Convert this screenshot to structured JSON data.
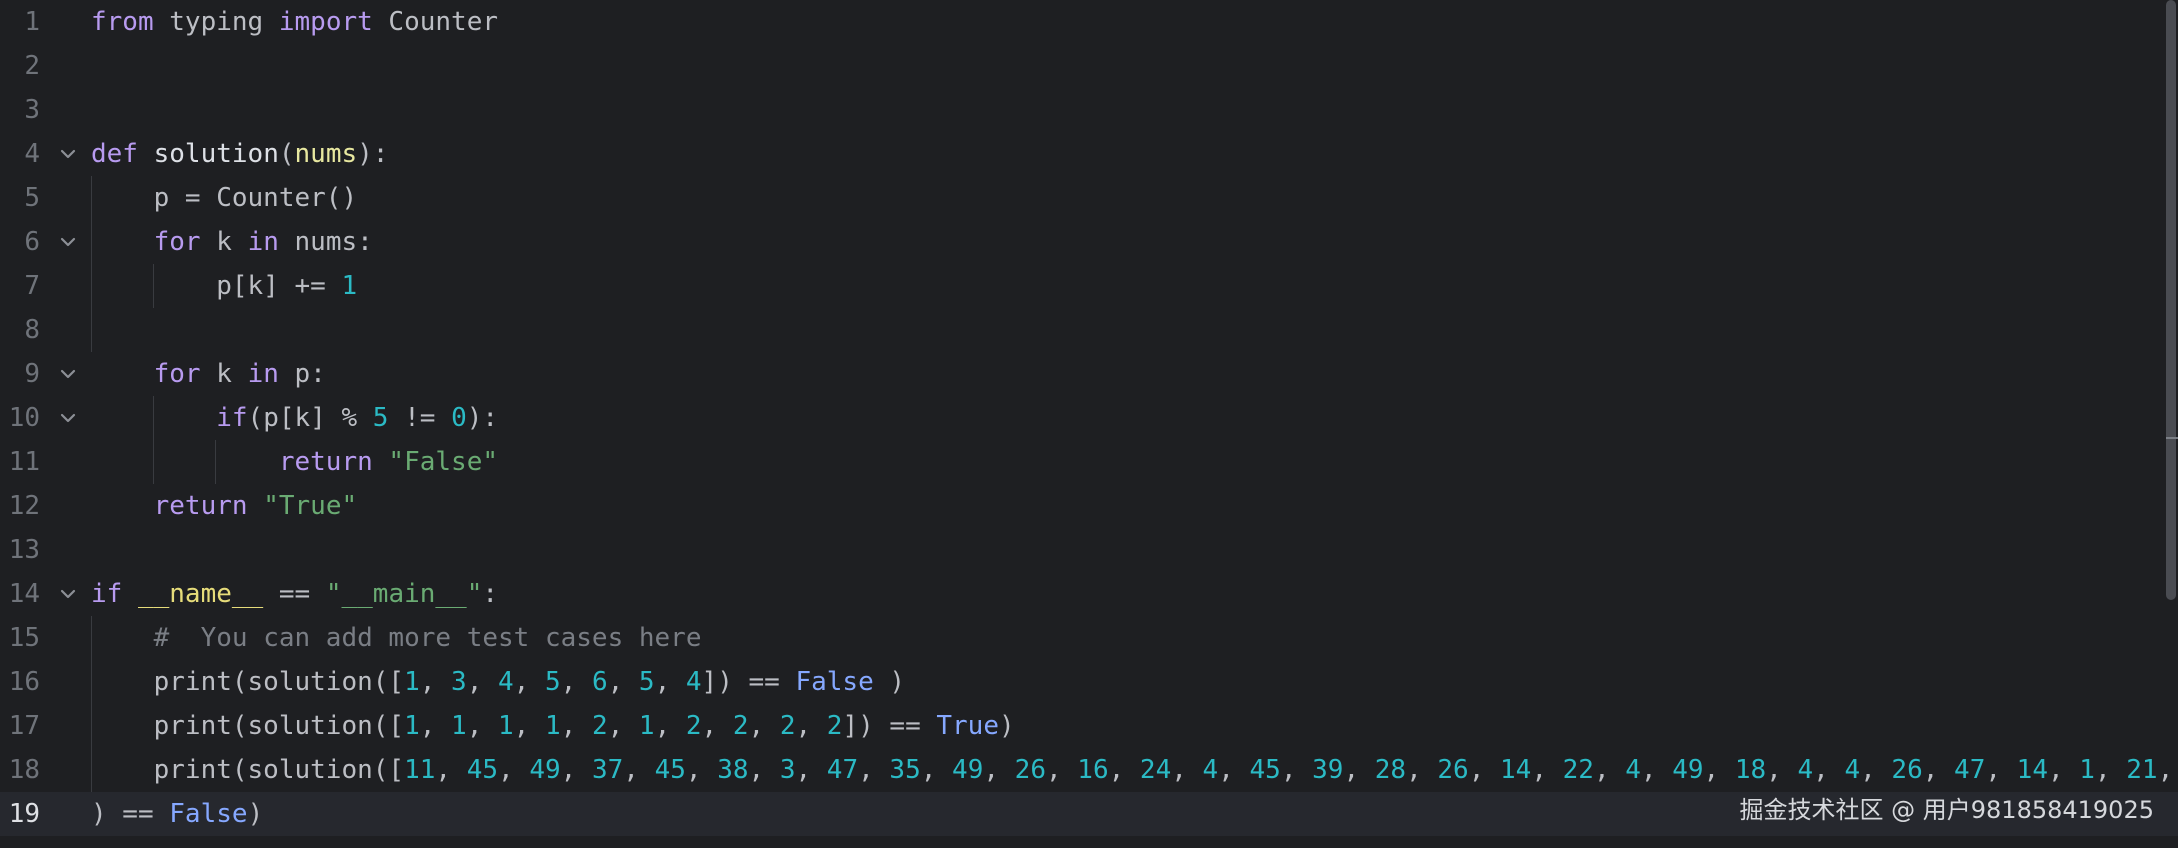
{
  "editor": {
    "lines": [
      {
        "num": "1",
        "tokens": [
          {
            "t": "kw",
            "v": "from"
          },
          {
            "t": "txt",
            "v": " typing "
          },
          {
            "t": "kw",
            "v": "import"
          },
          {
            "t": "txt",
            "v": " Counter"
          }
        ]
      },
      {
        "num": "2",
        "tokens": []
      },
      {
        "num": "3",
        "tokens": []
      },
      {
        "num": "4",
        "fold": true,
        "tokens": [
          {
            "t": "kw",
            "v": "def"
          },
          {
            "t": "txt",
            "v": " "
          },
          {
            "t": "fn",
            "v": "solution"
          },
          {
            "t": "txt",
            "v": "("
          },
          {
            "t": "param",
            "v": "nums"
          },
          {
            "t": "txt",
            "v": "):"
          }
        ]
      },
      {
        "num": "5",
        "tokens": [
          {
            "t": "txt",
            "v": "    p = Counter()"
          }
        ]
      },
      {
        "num": "6",
        "fold": true,
        "tokens": [
          {
            "t": "txt",
            "v": "    "
          },
          {
            "t": "kw",
            "v": "for"
          },
          {
            "t": "txt",
            "v": " k "
          },
          {
            "t": "kw",
            "v": "in"
          },
          {
            "t": "txt",
            "v": " nums:"
          }
        ]
      },
      {
        "num": "7",
        "tokens": [
          {
            "t": "txt",
            "v": "        p[k] += "
          },
          {
            "t": "num",
            "v": "1"
          }
        ]
      },
      {
        "num": "8",
        "tokens": []
      },
      {
        "num": "9",
        "fold": true,
        "tokens": [
          {
            "t": "txt",
            "v": "    "
          },
          {
            "t": "kw",
            "v": "for"
          },
          {
            "t": "txt",
            "v": " k "
          },
          {
            "t": "kw",
            "v": "in"
          },
          {
            "t": "txt",
            "v": " p:"
          }
        ]
      },
      {
        "num": "10",
        "fold": true,
        "tokens": [
          {
            "t": "txt",
            "v": "        "
          },
          {
            "t": "kw",
            "v": "if"
          },
          {
            "t": "txt",
            "v": "(p[k] % "
          },
          {
            "t": "num",
            "v": "5"
          },
          {
            "t": "txt",
            "v": " != "
          },
          {
            "t": "num",
            "v": "0"
          },
          {
            "t": "txt",
            "v": "):"
          }
        ]
      },
      {
        "num": "11",
        "tokens": [
          {
            "t": "txt",
            "v": "            "
          },
          {
            "t": "kw",
            "v": "return"
          },
          {
            "t": "txt",
            "v": " "
          },
          {
            "t": "str",
            "v": "\"False\""
          }
        ]
      },
      {
        "num": "12",
        "tokens": [
          {
            "t": "txt",
            "v": "    "
          },
          {
            "t": "kw",
            "v": "return"
          },
          {
            "t": "txt",
            "v": " "
          },
          {
            "t": "str",
            "v": "\"True\""
          }
        ]
      },
      {
        "num": "13",
        "tokens": []
      },
      {
        "num": "14",
        "fold": true,
        "tokens": [
          {
            "t": "kw",
            "v": "if"
          },
          {
            "t": "txt",
            "v": " "
          },
          {
            "t": "dunder",
            "v": "__name__"
          },
          {
            "t": "txt",
            "v": " == "
          },
          {
            "t": "str",
            "v": "\"__main__\""
          },
          {
            "t": "txt",
            "v": ":"
          }
        ]
      },
      {
        "num": "15",
        "tokens": [
          {
            "t": "txt",
            "v": "    "
          },
          {
            "t": "comment",
            "v": "#  You can add more test cases here"
          }
        ]
      },
      {
        "num": "16",
        "tokens": [
          {
            "t": "txt",
            "v": "    print(solution(["
          },
          {
            "t": "num",
            "v": "1"
          },
          {
            "t": "txt",
            "v": ", "
          },
          {
            "t": "num",
            "v": "3"
          },
          {
            "t": "txt",
            "v": ", "
          },
          {
            "t": "num",
            "v": "4"
          },
          {
            "t": "txt",
            "v": ", "
          },
          {
            "t": "num",
            "v": "5"
          },
          {
            "t": "txt",
            "v": ", "
          },
          {
            "t": "num",
            "v": "6"
          },
          {
            "t": "txt",
            "v": ", "
          },
          {
            "t": "num",
            "v": "5"
          },
          {
            "t": "txt",
            "v": ", "
          },
          {
            "t": "num",
            "v": "4"
          },
          {
            "t": "txt",
            "v": "]) == "
          },
          {
            "t": "bool",
            "v": "False"
          },
          {
            "t": "txt",
            "v": " )"
          }
        ]
      },
      {
        "num": "17",
        "tokens": [
          {
            "t": "txt",
            "v": "    print(solution(["
          },
          {
            "t": "num",
            "v": "1"
          },
          {
            "t": "txt",
            "v": ", "
          },
          {
            "t": "num",
            "v": "1"
          },
          {
            "t": "txt",
            "v": ", "
          },
          {
            "t": "num",
            "v": "1"
          },
          {
            "t": "txt",
            "v": ", "
          },
          {
            "t": "num",
            "v": "1"
          },
          {
            "t": "txt",
            "v": ", "
          },
          {
            "t": "num",
            "v": "2"
          },
          {
            "t": "txt",
            "v": ", "
          },
          {
            "t": "num",
            "v": "1"
          },
          {
            "t": "txt",
            "v": ", "
          },
          {
            "t": "num",
            "v": "2"
          },
          {
            "t": "txt",
            "v": ", "
          },
          {
            "t": "num",
            "v": "2"
          },
          {
            "t": "txt",
            "v": ", "
          },
          {
            "t": "num",
            "v": "2"
          },
          {
            "t": "txt",
            "v": ", "
          },
          {
            "t": "num",
            "v": "2"
          },
          {
            "t": "txt",
            "v": "]) == "
          },
          {
            "t": "bool",
            "v": "True"
          },
          {
            "t": "txt",
            "v": ")"
          }
        ]
      },
      {
        "num": "18",
        "tokens": [
          {
            "t": "txt",
            "v": "    print(solution(["
          },
          {
            "t": "num",
            "v": "11"
          },
          {
            "t": "txt",
            "v": ", "
          },
          {
            "t": "num",
            "v": "45"
          },
          {
            "t": "txt",
            "v": ", "
          },
          {
            "t": "num",
            "v": "49"
          },
          {
            "t": "txt",
            "v": ", "
          },
          {
            "t": "num",
            "v": "37"
          },
          {
            "t": "txt",
            "v": ", "
          },
          {
            "t": "num",
            "v": "45"
          },
          {
            "t": "txt",
            "v": ", "
          },
          {
            "t": "num",
            "v": "38"
          },
          {
            "t": "txt",
            "v": ", "
          },
          {
            "t": "num",
            "v": "3"
          },
          {
            "t": "txt",
            "v": ", "
          },
          {
            "t": "num",
            "v": "47"
          },
          {
            "t": "txt",
            "v": ", "
          },
          {
            "t": "num",
            "v": "35"
          },
          {
            "t": "txt",
            "v": ", "
          },
          {
            "t": "num",
            "v": "49"
          },
          {
            "t": "txt",
            "v": ", "
          },
          {
            "t": "num",
            "v": "26"
          },
          {
            "t": "txt",
            "v": ", "
          },
          {
            "t": "num",
            "v": "16"
          },
          {
            "t": "txt",
            "v": ", "
          },
          {
            "t": "num",
            "v": "24"
          },
          {
            "t": "txt",
            "v": ", "
          },
          {
            "t": "num",
            "v": "4"
          },
          {
            "t": "txt",
            "v": ", "
          },
          {
            "t": "num",
            "v": "45"
          },
          {
            "t": "txt",
            "v": ", "
          },
          {
            "t": "num",
            "v": "39"
          },
          {
            "t": "txt",
            "v": ", "
          },
          {
            "t": "num",
            "v": "28"
          },
          {
            "t": "txt",
            "v": ", "
          },
          {
            "t": "num",
            "v": "26"
          },
          {
            "t": "txt",
            "v": ", "
          },
          {
            "t": "num",
            "v": "14"
          },
          {
            "t": "txt",
            "v": ", "
          },
          {
            "t": "num",
            "v": "22"
          },
          {
            "t": "txt",
            "v": ", "
          },
          {
            "t": "num",
            "v": "4"
          },
          {
            "t": "txt",
            "v": ", "
          },
          {
            "t": "num",
            "v": "49"
          },
          {
            "t": "txt",
            "v": ", "
          },
          {
            "t": "num",
            "v": "18"
          },
          {
            "t": "txt",
            "v": ", "
          },
          {
            "t": "num",
            "v": "4"
          },
          {
            "t": "txt",
            "v": ", "
          },
          {
            "t": "num",
            "v": "4"
          },
          {
            "t": "txt",
            "v": ", "
          },
          {
            "t": "num",
            "v": "26"
          },
          {
            "t": "txt",
            "v": ", "
          },
          {
            "t": "num",
            "v": "47"
          },
          {
            "t": "txt",
            "v": ", "
          },
          {
            "t": "num",
            "v": "14"
          },
          {
            "t": "txt",
            "v": ", "
          },
          {
            "t": "num",
            "v": "1"
          },
          {
            "t": "txt",
            "v": ", "
          },
          {
            "t": "num",
            "v": "21"
          },
          {
            "t": "txt",
            "v": ","
          }
        ]
      },
      {
        "num": "19",
        "current": true,
        "tokens": [
          {
            "t": "txt",
            "v": ") == "
          },
          {
            "t": "bool",
            "v": "False"
          },
          {
            "t": "txt",
            "v": ")"
          }
        ]
      }
    ]
  },
  "watermark": "掘金技术社区 @ 用户981858419025",
  "colors": {
    "background": "#1e1f22",
    "current_line": "#26282e",
    "keyword": "#b89bf0",
    "number": "#2bbac5",
    "string": "#6aab73",
    "comment": "#7a7e85",
    "boolean": "#86a8ff"
  }
}
